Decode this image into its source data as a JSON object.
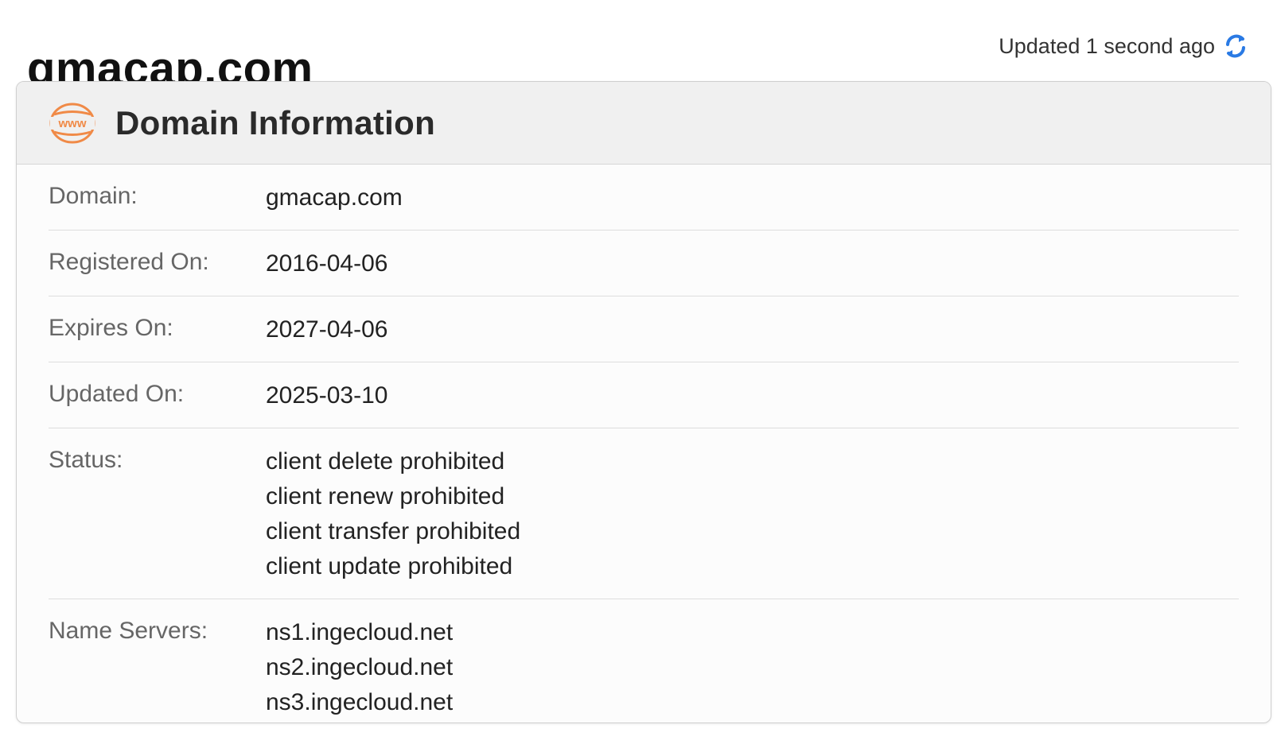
{
  "page": {
    "title": "gmacap.com",
    "updated_text": "Updated 1 second ago"
  },
  "icons": {
    "refresh": "refresh-icon",
    "www": "www-globe-icon"
  },
  "colors": {
    "refresh_icon": "#2a7ae4",
    "www_icon": "#f08a47"
  },
  "card": {
    "title": "Domain Information",
    "www_icon_text": "www",
    "rows": [
      {
        "label": "Domain:",
        "values": [
          "gmacap.com"
        ]
      },
      {
        "label": "Registered On:",
        "values": [
          "2016-04-06"
        ]
      },
      {
        "label": "Expires On:",
        "values": [
          "2027-04-06"
        ]
      },
      {
        "label": "Updated On:",
        "values": [
          "2025-03-10"
        ]
      },
      {
        "label": "Status:",
        "values": [
          "client delete prohibited",
          "client renew prohibited",
          "client transfer prohibited",
          "client update prohibited"
        ]
      },
      {
        "label": "Name Servers:",
        "values": [
          "ns1.ingecloud.net",
          "ns2.ingecloud.net",
          "ns3.ingecloud.net"
        ]
      }
    ]
  }
}
